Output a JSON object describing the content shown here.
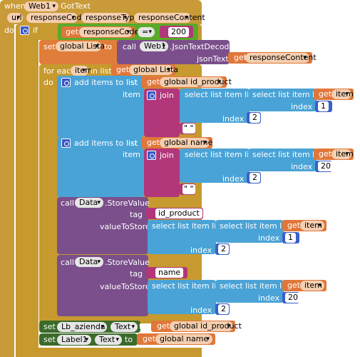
{
  "event": {
    "when": "when",
    "component": "Web1",
    "event": "GotText",
    "params": [
      "url",
      "responseCode",
      "responseType",
      "responseContent"
    ],
    "do": "do"
  },
  "if_block": {
    "label": "if",
    "then": "then",
    "get": "get",
    "var": "responseCode",
    "op": "=",
    "value": "200"
  },
  "set_lista": {
    "set": "set",
    "var": "global Lista",
    "to": "to",
    "call": "call",
    "comp": "Web1",
    "method": ".JsonTextDecode",
    "param": "jsonText",
    "get": "get",
    "arg": "responseContent"
  },
  "foreach": {
    "label": "for each",
    "item": "item",
    "in_list": "in list",
    "get": "get",
    "list": "global Lista",
    "do": "do"
  },
  "add1": {
    "label": "add items to list",
    "list_label": "list",
    "item_label": "item",
    "get": "get",
    "list_var": "global id_product",
    "join": "join",
    "select1": "select list item  list",
    "select2": "select list item  list",
    "get_item": "item",
    "index": "index",
    "inner_index": "1",
    "outer_index": "2",
    "empty": "\" \""
  },
  "add2": {
    "label": "add items to list",
    "list_label": "list",
    "item_label": "item",
    "get": "get",
    "list_var": "global name",
    "join": "join",
    "select1": "select list item  list",
    "select2": "select list item  list",
    "get_item": "item",
    "index": "index",
    "inner_index": "20",
    "outer_index": "2",
    "empty": "\" \""
  },
  "store1": {
    "call": "call",
    "comp": "Data",
    "method": ".StoreValue",
    "tag": "tag",
    "tag_val": "id_product",
    "value_label": "valueToStore",
    "select1": "select list item  list",
    "select2": "select list item  list",
    "get": "get",
    "get_item": "item",
    "index": "index",
    "inner_index": "1",
    "outer_index": "2"
  },
  "store2": {
    "call": "call",
    "comp": "Data",
    "method": ".StoreValue",
    "tag": "tag",
    "tag_val": "name",
    "value_label": "valueToStore",
    "select1": "select list item  list",
    "select2": "select list item  list",
    "get": "get",
    "get_item": "item",
    "index": "index",
    "inner_index": "20",
    "outer_index": "2"
  },
  "set_lb": {
    "set": "set",
    "comp": "Lb_azienda",
    "prop": "Text",
    "to": "to",
    "get": "get",
    "var": "global id_product"
  },
  "set_label1": {
    "set": "set",
    "comp": "Label1",
    "prop": "Text",
    "to": "to",
    "get": "get",
    "var": "global name"
  },
  "colors": {
    "event": "#c89b38",
    "control": "#c79a2f",
    "variable": "#e07d3a",
    "procedure_call": "#7a4f8b",
    "list": "#4aa3d6",
    "text": "#b2367a",
    "logic": "#5aaa2a",
    "component_setter": "#3b6a2a"
  }
}
